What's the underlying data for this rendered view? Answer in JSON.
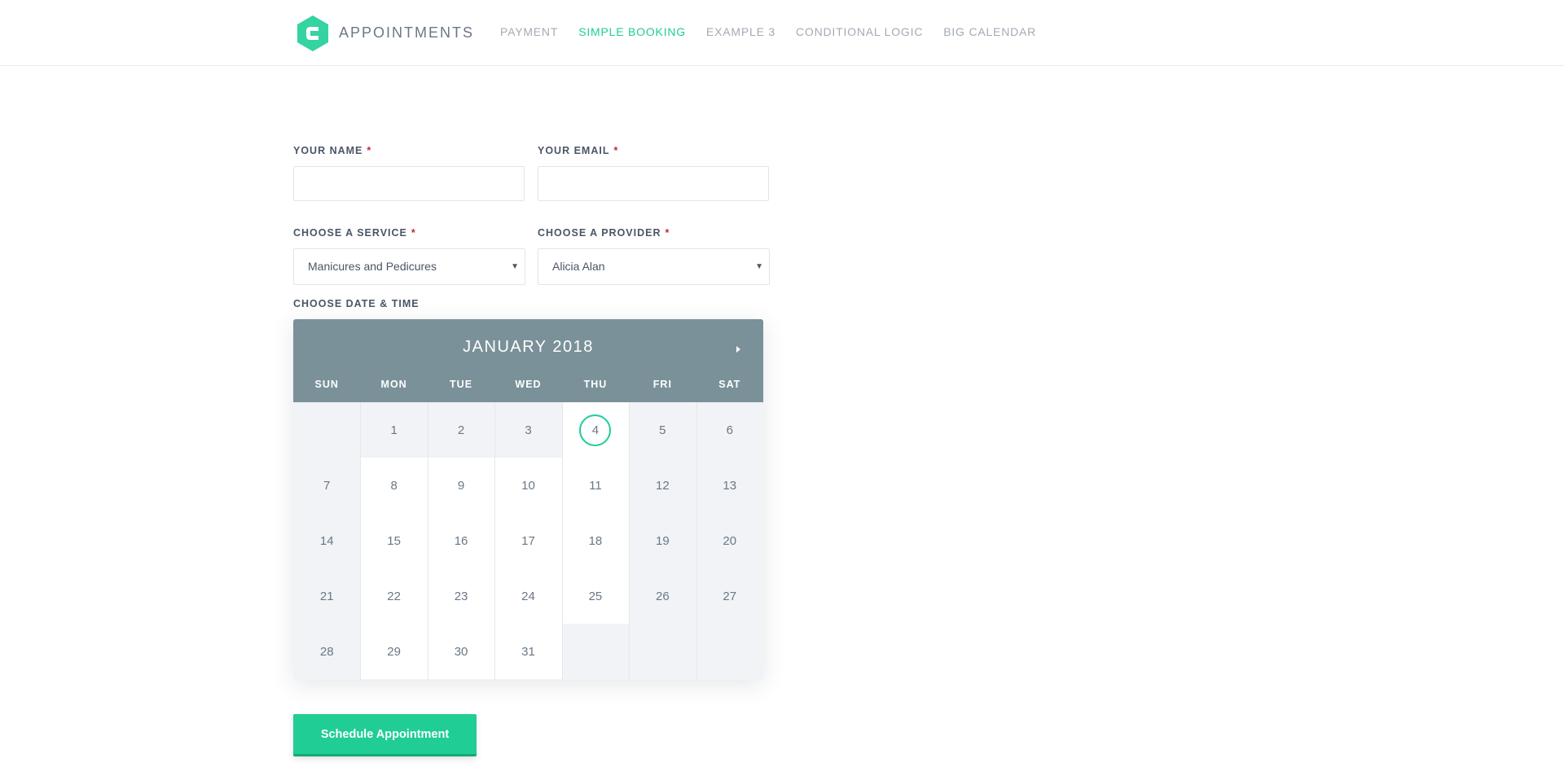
{
  "header": {
    "brand": "APPOINTMENTS",
    "accent_color": "#1fcd95",
    "logo_icon": "gravity-forms-hexagon-logo",
    "nav": [
      {
        "label": "PAYMENT",
        "active": false
      },
      {
        "label": "SIMPLE BOOKING",
        "active": true
      },
      {
        "label": "EXAMPLE 3",
        "active": false
      },
      {
        "label": "CONDITIONAL LOGIC",
        "active": false
      },
      {
        "label": "BIG CALENDAR",
        "active": false
      }
    ]
  },
  "form": {
    "name": {
      "label": "YOUR NAME",
      "required": "*",
      "value": ""
    },
    "email": {
      "label": "YOUR EMAIL",
      "required": "*",
      "value": ""
    },
    "service": {
      "label": "CHOOSE A SERVICE",
      "required": "*",
      "selected": "Manicures and Pedicures"
    },
    "provider": {
      "label": "CHOOSE A PROVIDER",
      "required": "*",
      "selected": "Alicia Alan"
    },
    "datetime_label": "CHOOSE DATE & TIME",
    "submit_label": "Schedule Appointment"
  },
  "calendar": {
    "title": "JANUARY 2018",
    "next_icon": "caret-right-icon",
    "weekdays": [
      "SUN",
      "MON",
      "TUE",
      "WED",
      "THU",
      "FRI",
      "SAT"
    ],
    "first_weekday_index": 1,
    "days_in_month": 31,
    "available_days": [
      4,
      8,
      9,
      10,
      11,
      15,
      16,
      17,
      18,
      22,
      23,
      24,
      25,
      29,
      30,
      31
    ],
    "selected_day": 4,
    "header_color": "#7b9199"
  }
}
